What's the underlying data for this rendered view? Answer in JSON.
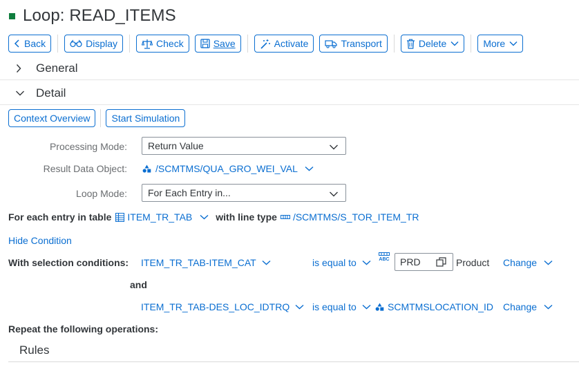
{
  "header": {
    "title": "Loop: READ_ITEMS"
  },
  "toolbar": {
    "back": "Back",
    "display": "Display",
    "check": "Check",
    "save": "Save",
    "activate": "Activate",
    "transport": "Transport",
    "delete": "Delete",
    "more": "More"
  },
  "sections": {
    "general": "General",
    "detail": "Detail",
    "rules": "Rules"
  },
  "detail_buttons": {
    "context_overview": "Context Overview",
    "start_simulation": "Start Simulation"
  },
  "form": {
    "processing_mode_label": "Processing Mode:",
    "processing_mode_value": "Return Value",
    "result_data_object_label": "Result Data Object:",
    "result_data_object_value": "/SCMTMS/QUA_GRO_WEI_VAL",
    "loop_mode_label": "Loop Mode:",
    "loop_mode_value": "For Each Entry in..."
  },
  "table_row": {
    "prefix": "For each entry in table",
    "table_name": "ITEM_TR_TAB",
    "line_type_label": "with line type",
    "line_type_value": "/SCMTMS/S_TOR_ITEM_TR"
  },
  "hide_condition": "Hide Condition",
  "conditions": {
    "label": "With selection conditions:",
    "and_label": "and",
    "items": [
      {
        "field": "ITEM_TR_TAB-ITEM_CAT",
        "operator": "is equal to",
        "value": "PRD",
        "value_text": "Product",
        "change": "Change",
        "type_badge": "ABC"
      },
      {
        "field": "ITEM_TR_TAB-DES_LOC_IDTRQ",
        "operator": "is equal to",
        "value": "SCMTMSLOCATION_ID",
        "change": "Change"
      }
    ]
  },
  "repeat_label": "Repeat the following operations:",
  "colors": {
    "accent": "#0a6ed1",
    "title_square": "#107e3e",
    "text": "#32363a",
    "label": "#6a6d70"
  }
}
